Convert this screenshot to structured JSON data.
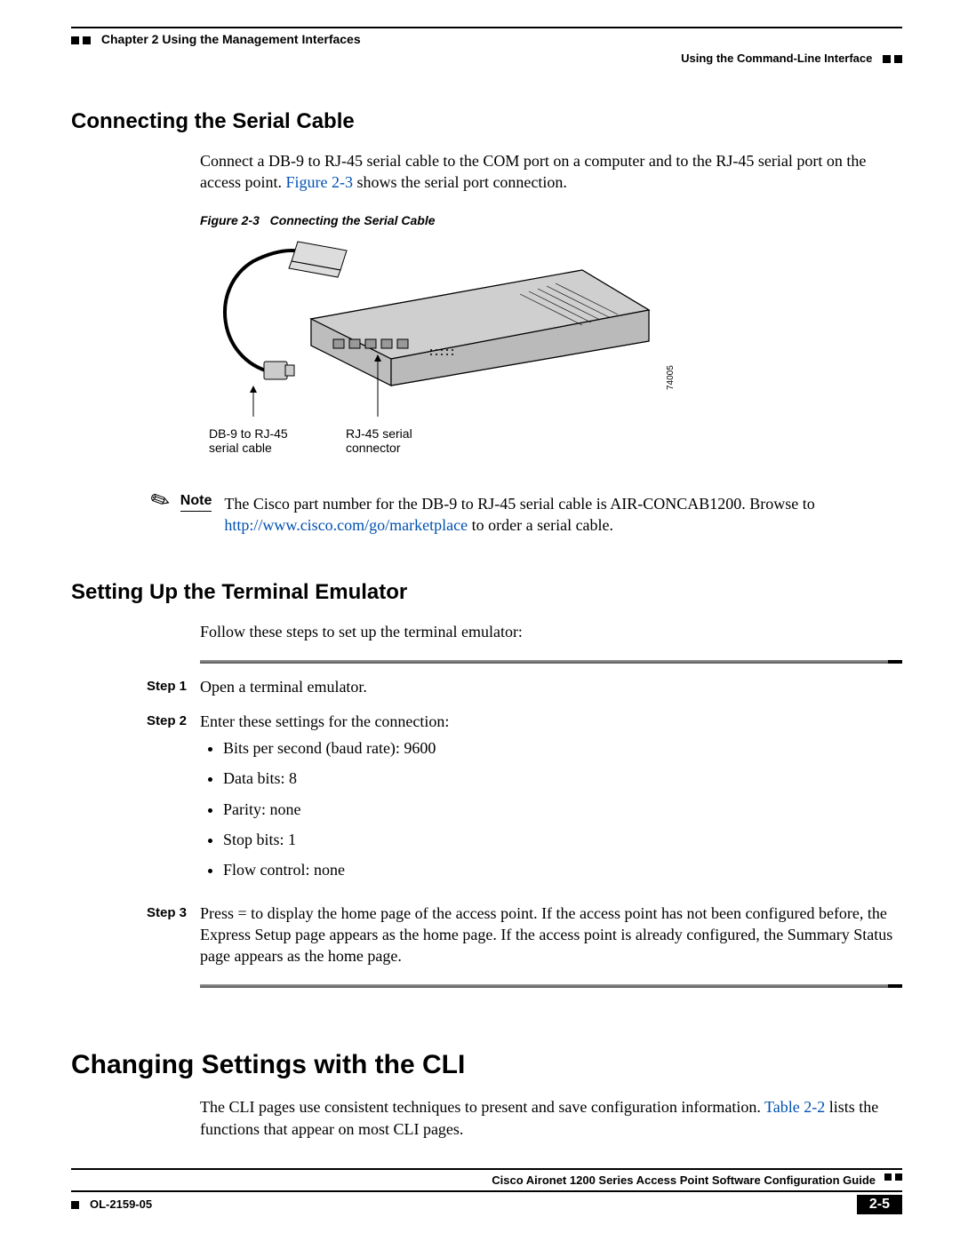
{
  "header": {
    "chapter": "Chapter 2      Using the Management Interfaces",
    "section_right": "Using the Command-Line Interface"
  },
  "sec1": {
    "title": "Connecting the Serial Cable",
    "para_a": "Connect a DB-9 to RJ-45 serial cable to the COM port on a computer and to the RJ-45 serial port on the access point. ",
    "fig_ref": "Figure 2-3",
    "para_b": " shows the serial port connection.",
    "fig_caption_label": "Figure 2-3",
    "fig_caption_text": "Connecting the Serial Cable",
    "label_left_1": "DB-9 to RJ-45",
    "label_left_2": "serial cable",
    "label_mid_1": "RJ-45 serial",
    "label_mid_2": "connector",
    "drawing_id": "74005"
  },
  "note": {
    "label": "Note",
    "text_a": "The Cisco part number for the DB-9 to RJ-45 serial cable is AIR-CONCAB1200. Browse to ",
    "url": "http://www.cisco.com/go/marketplace",
    "text_b": " to order a serial cable."
  },
  "sec2": {
    "title": "Setting Up the Terminal Emulator",
    "intro": "Follow these steps to set up the terminal emulator:",
    "steps": [
      {
        "label": "Step 1",
        "text": "Open a terminal emulator."
      },
      {
        "label": "Step 2",
        "text": "Enter these settings for the connection:",
        "bullets": [
          "Bits per second (baud rate): 9600",
          "Data bits: 8",
          "Parity: none",
          "Stop bits: 1",
          "Flow control: none"
        ]
      },
      {
        "label": "Step 3",
        "text": "Press = to display the home page of the access point. If the access point has not been configured before, the Express Setup page appears as the home page. If the access point is already configured, the Summary Status page appears as the home page."
      }
    ]
  },
  "sec3": {
    "title": "Changing Settings with the CLI",
    "para_a": "The CLI pages use consistent techniques to present and save configuration information. ",
    "table_ref": "Table 2-2",
    "para_b": " lists the functions that appear on most CLI pages."
  },
  "footer": {
    "guide": "Cisco Aironet 1200 Series Access Point Software Configuration Guide",
    "docid": "OL-2159-05",
    "page": "2-5"
  }
}
